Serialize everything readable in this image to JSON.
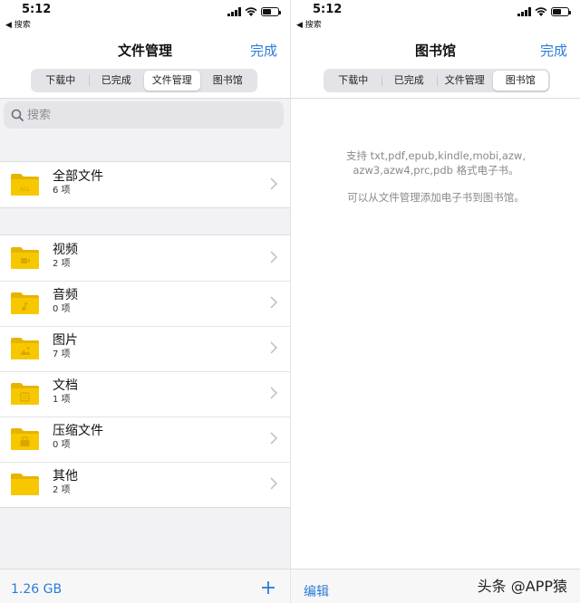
{
  "left": {
    "status": {
      "time": "5:12",
      "back": "◀ 搜索"
    },
    "title": "文件管理",
    "done": "完成",
    "tabs": [
      "下载中",
      "已完成",
      "文件管理",
      "图书馆"
    ],
    "search_placeholder": "搜索",
    "top_item": {
      "name": "全部文件",
      "count": "6 项",
      "icon": "folder-all-icon",
      "badge": "ALL"
    },
    "items": [
      {
        "name": "视频",
        "count": "2 项",
        "icon": "folder-video-icon"
      },
      {
        "name": "音频",
        "count": "0 项",
        "icon": "folder-audio-icon"
      },
      {
        "name": "图片",
        "count": "7 项",
        "icon": "folder-image-icon"
      },
      {
        "name": "文档",
        "count": "1 项",
        "icon": "folder-document-icon"
      },
      {
        "name": "压缩文件",
        "count": "0 项",
        "icon": "folder-archive-icon"
      },
      {
        "name": "其他",
        "count": "2 项",
        "icon": "folder-other-icon"
      }
    ],
    "footer": {
      "storage": "1.26 GB"
    }
  },
  "right": {
    "status": {
      "time": "5:12",
      "back": "◀ 搜索"
    },
    "title": "图书馆",
    "done": "完成",
    "tabs": [
      "下载中",
      "已完成",
      "文件管理",
      "图书馆"
    ],
    "info_line1": "支持 txt,pdf,epub,kindle,mobi,azw,azw3,azw4,prc,pdb 格式电子书。",
    "info_line2": "可以从文件管理添加电子书到图书馆。",
    "footer": {
      "edit": "编辑",
      "watermark": "头条 @APP猿"
    }
  },
  "colors": {
    "accent": "#2b7cd6",
    "folder": "#f7c800",
    "folder_dark": "#e6b400"
  }
}
